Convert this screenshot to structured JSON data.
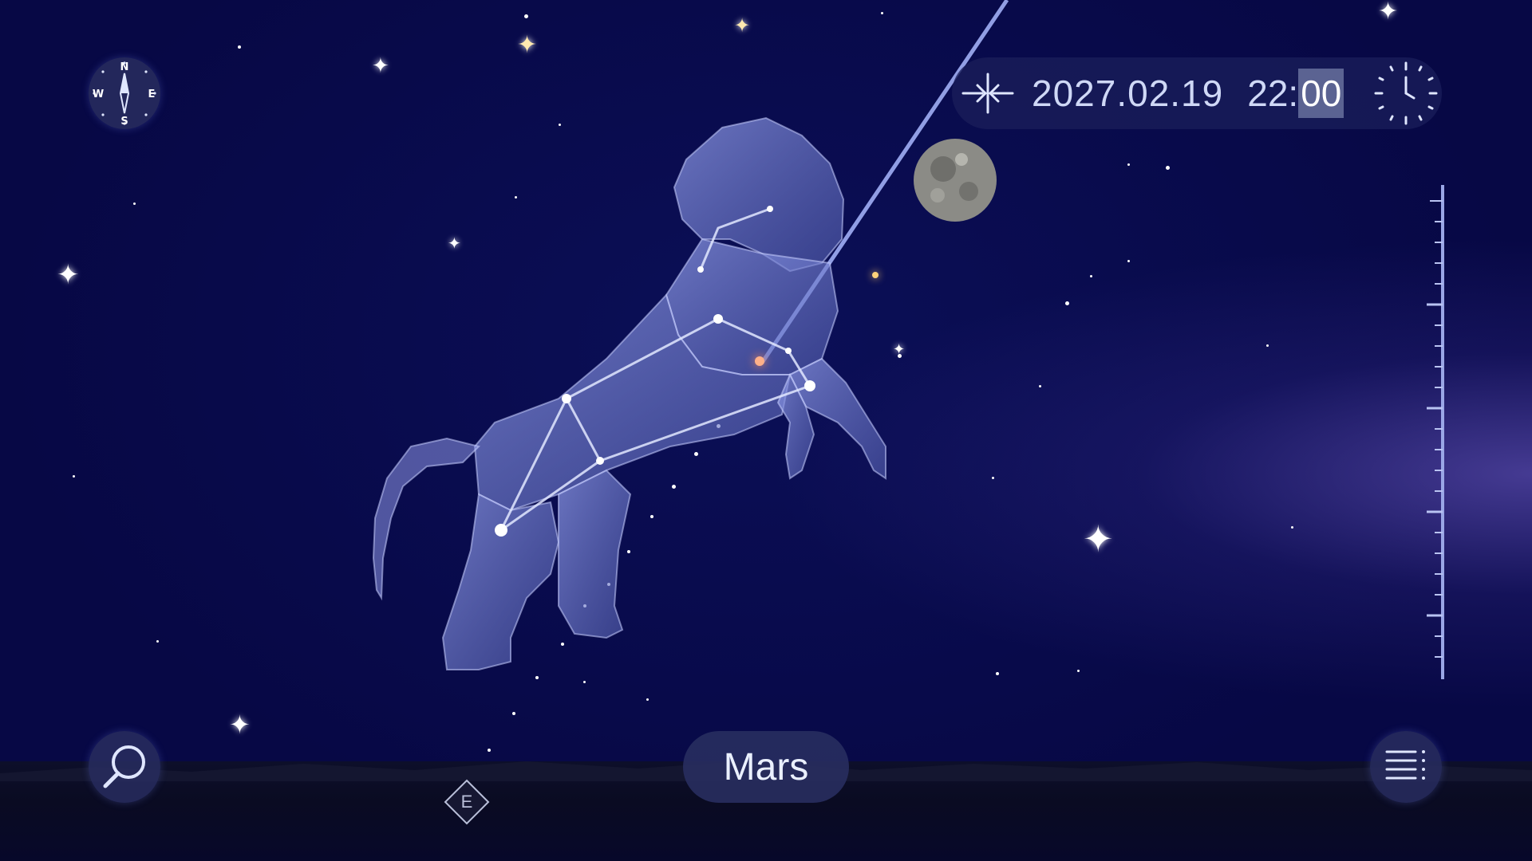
{
  "datetime": {
    "date": "2027.02.19",
    "hour": "22:",
    "minute": "00"
  },
  "selected_object": {
    "name": "Mars"
  },
  "compass": {
    "north": "N",
    "east": "E",
    "south": "S",
    "west": "W"
  },
  "horizon": {
    "direction_label": "E"
  },
  "constellation": {
    "figure": "lion"
  },
  "icons": {
    "compass": "compass-icon",
    "search": "search-icon",
    "menu": "menu-icon",
    "center": "center-view-icon",
    "clock": "clock-icon"
  },
  "colors": {
    "sky": "#06073f",
    "constellation_figure": "#8f9ce8",
    "pointer_beam": "#a9b8ff",
    "mars": "#ffb089",
    "button_bg": "#282d5f",
    "time_highlight": "#5b6392"
  }
}
